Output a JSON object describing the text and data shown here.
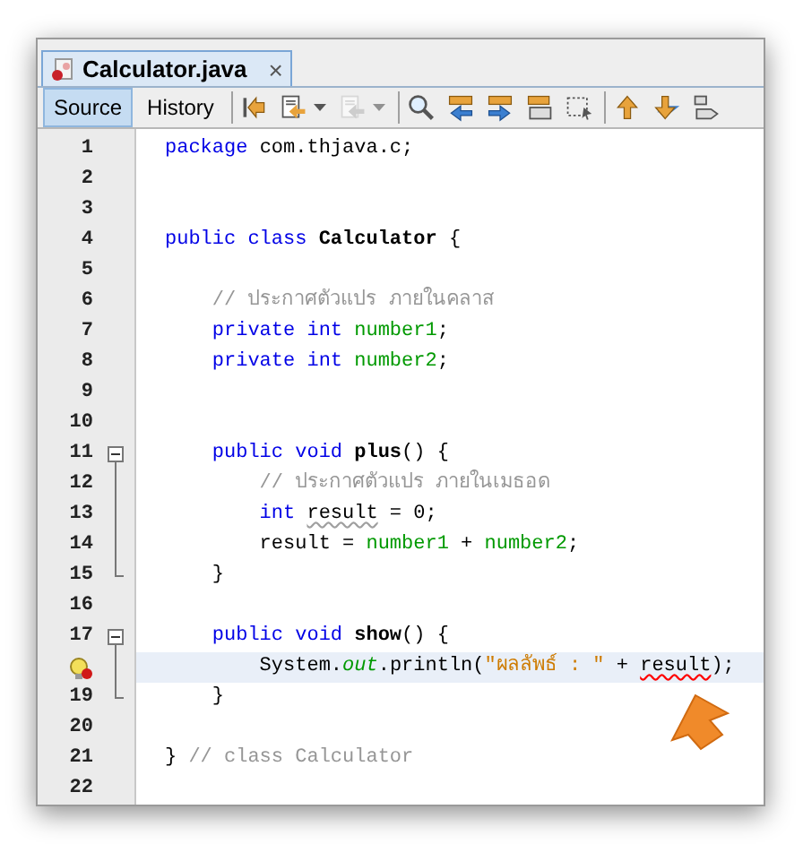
{
  "tab": {
    "title": "Calculator.java",
    "close": "×",
    "selected": true
  },
  "views": [
    {
      "label": "Source",
      "selected": true
    },
    {
      "label": "History",
      "selected": false
    }
  ],
  "toolbar": [
    {
      "kind": "back",
      "disabled": false,
      "menu": false
    },
    {
      "kind": "prev-edit",
      "disabled": false,
      "menu": true
    },
    {
      "kind": "next-edit",
      "disabled": true,
      "menu": true
    },
    {
      "kind": "find",
      "disabled": false,
      "menu": false
    },
    {
      "kind": "find-prev",
      "disabled": false,
      "menu": false
    },
    {
      "kind": "find-next",
      "disabled": false,
      "menu": false
    },
    {
      "kind": "highlight",
      "disabled": false,
      "menu": false
    },
    {
      "kind": "select",
      "disabled": false,
      "menu": false
    },
    {
      "kind": "up",
      "disabled": false,
      "menu": false
    },
    {
      "kind": "down",
      "disabled": false,
      "menu": false
    },
    {
      "kind": "right",
      "disabled": false,
      "menu": false
    }
  ],
  "lines": [
    {
      "number": "1",
      "tokens": [
        {
          "text": "package",
          "kind": "keyword"
        },
        {
          "text": " com.thjava.c;",
          "kind": "plain"
        }
      ]
    },
    {
      "number": "2"
    },
    {
      "number": "3"
    },
    {
      "number": "4",
      "tokens": [
        {
          "text": "public class",
          "kind": "keyword"
        },
        {
          "text": " Calculator ",
          "kind": "bold"
        },
        {
          "text": "{",
          "kind": "plain"
        }
      ]
    },
    {
      "number": "5"
    },
    {
      "number": "6",
      "tokens": [
        {
          "text": "    // ประกาศตัวแปร ภายในคลาส",
          "kind": "comment"
        }
      ]
    },
    {
      "number": "7",
      "tokens": [
        {
          "text": "    private int",
          "kind": "keyword"
        },
        {
          "text": " number1",
          "kind": "field"
        },
        {
          "text": ";",
          "kind": "plain"
        }
      ]
    },
    {
      "number": "8",
      "tokens": [
        {
          "text": "    private int",
          "kind": "keyword"
        },
        {
          "text": " number2",
          "kind": "field"
        },
        {
          "text": ";",
          "kind": "plain"
        }
      ]
    },
    {
      "number": "9"
    },
    {
      "number": "10"
    },
    {
      "number": "11",
      "expanded": true,
      "tokens": [
        {
          "text": "    public void",
          "kind": "keyword"
        },
        {
          "text": " plus",
          "kind": "bold"
        },
        {
          "text": "() {",
          "kind": "plain"
        }
      ],
      "children": [
        {
          "number": "12",
          "tokens": [
            {
              "text": "        // ประกาศตัวแปร ภายในเมธอด",
              "kind": "comment"
            }
          ]
        },
        {
          "number": "13",
          "tokens": [
            {
              "text": "        int ",
              "kind": "keyword"
            },
            {
              "text": "result",
              "kind": "warning"
            },
            {
              "text": " = 0;",
              "kind": "plain"
            }
          ]
        },
        {
          "number": "14",
          "tokens": [
            {
              "text": "        result = ",
              "kind": "plain"
            },
            {
              "text": "number1",
              "kind": "field"
            },
            {
              "text": " + ",
              "kind": "plain"
            },
            {
              "text": "number2",
              "kind": "field"
            },
            {
              "text": ";",
              "kind": "plain"
            }
          ]
        },
        {
          "number": "15",
          "tokens": [
            {
              "text": "    }",
              "kind": "plain"
            }
          ]
        }
      ]
    },
    {
      "number": "16"
    },
    {
      "number": "17",
      "expanded": true,
      "tokens": [
        {
          "text": "    public void",
          "kind": "keyword"
        },
        {
          "text": " show",
          "kind": "bold"
        },
        {
          "text": "() {",
          "kind": "plain"
        }
      ],
      "children": [
        {
          "error": true,
          "highlighted": true,
          "tokens": [
            {
              "text": "        System.",
              "kind": "plain"
            },
            {
              "text": "out",
              "kind": "static"
            },
            {
              "text": ".println(",
              "kind": "plain"
            },
            {
              "text": "\"ผลลัพธ์ : \"",
              "kind": "string"
            },
            {
              "text": " + ",
              "kind": "plain"
            },
            {
              "text": "result",
              "kind": "error"
            },
            {
              "text": ");",
              "kind": "plain"
            }
          ]
        },
        {
          "number": "19",
          "tokens": [
            {
              "text": "    }",
              "kind": "plain"
            }
          ]
        }
      ]
    },
    {
      "number": "20"
    },
    {
      "number": "21",
      "tokens": [
        {
          "text": "} ",
          "kind": "plain"
        },
        {
          "text": "// class Calculator",
          "kind": "comment"
        }
      ]
    },
    {
      "number": "22"
    }
  ]
}
